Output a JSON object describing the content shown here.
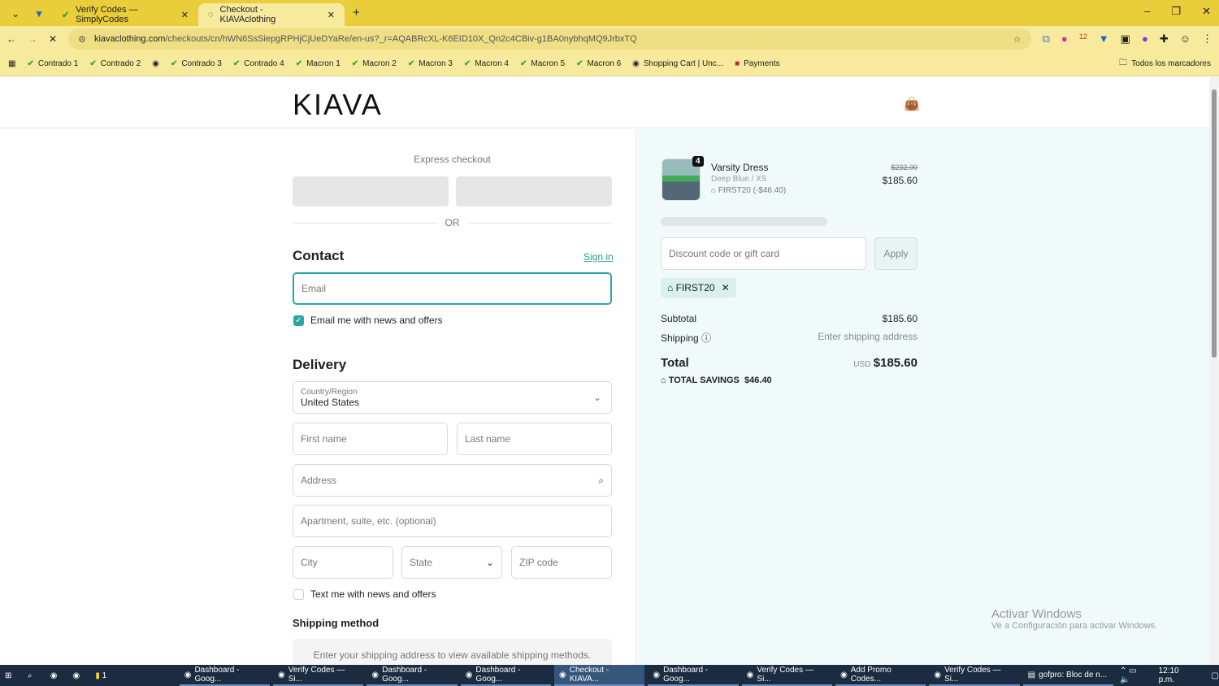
{
  "browser": {
    "tabs": [
      {
        "label": "Verify Codes — SimplyCodes"
      },
      {
        "label": "Checkout - KIAVAclothing"
      }
    ],
    "url_domain": "kiavaclothing.com",
    "url_path": "/checkouts/cn/hWN6SsSiepgRPHjCjUeDYaRe/en-us?_r=AQABRcXL-K6EID10X_Qn2c4CBiv-g1BA0nybhqMQ9JrbxTQ",
    "bookmarks": [
      "Contrado 1",
      "Contrado 2",
      "Contrado 3",
      "Contrado 4",
      "Macron 1",
      "Macron 2",
      "Macron 3",
      "Macron 4",
      "Macron 5",
      "Macron 6",
      "Shopping Cart | Unc...",
      "Payments"
    ],
    "all_bookmarks": "Todos los marcadores",
    "ext_badge": "12"
  },
  "logo": "KIAVA",
  "checkout": {
    "express": "Express checkout",
    "or": "OR",
    "contact": "Contact",
    "sign_in": "Sign in",
    "email_placeholder": "Email",
    "email_news": "Email me with news and offers",
    "delivery": "Delivery",
    "country_label": "Country/Region",
    "country": "United States",
    "first_name": "First name",
    "last_name": "Last name",
    "address": "Address",
    "apartment": "Apartment, suite, etc. (optional)",
    "city": "City",
    "state": "State",
    "zip": "ZIP code",
    "text_news": "Text me with news and offers",
    "shipping_method": "Shipping method",
    "shipping_note": "Enter your shipping address to view available shipping methods."
  },
  "summary": {
    "item": {
      "name": "Varsity Dress",
      "variant": "Deep Blue / XS",
      "discount": "FIRST20 (-$46.40)",
      "qty": "4",
      "orig_price": "$232.00",
      "price": "$185.60"
    },
    "discount_placeholder": "Discount code or gift card",
    "apply": "Apply",
    "code": "FIRST20",
    "subtotal_label": "Subtotal",
    "subtotal": "$185.60",
    "shipping_label": "Shipping",
    "shipping_value": "Enter shipping address",
    "total_label": "Total",
    "currency": "USD",
    "total": "$185.60",
    "savings_label": "TOTAL SAVINGS",
    "savings": "$46.40"
  },
  "watermark": {
    "title": "Activar Windows",
    "sub": "Ve a Configuración para activar Windows."
  },
  "taskbar": {
    "items": [
      "Dashboard - Goog...",
      "Verify Codes — Si...",
      "Dashboard - Goog...",
      "Dashboard - Goog...",
      "Checkout - KIAVA...",
      "Dashboard - Goog...",
      "Verify Codes — Si...",
      "Add Promo Codes...",
      "Verify Codes — Si...",
      "gofpro: Bloc de n..."
    ],
    "folder_count": "1",
    "time": "12:10 p.m."
  }
}
